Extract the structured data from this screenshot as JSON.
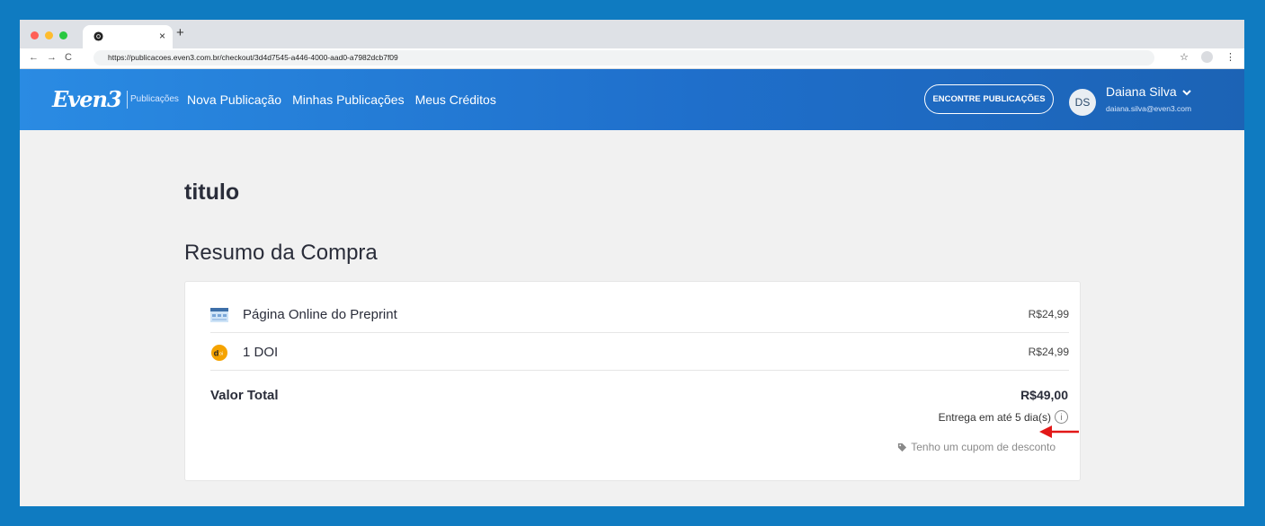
{
  "browser": {
    "url": "https://publicacoes.even3.com.br/checkout/3d4d7545-a446-4000-aad0-a7982dcb7f09",
    "tab_close": "×",
    "new_tab": "+"
  },
  "header": {
    "logo": "Even3",
    "logo_sub": "Publicações",
    "nav": [
      "Nova Publicação",
      "Minhas Publicações",
      "Meus Créditos"
    ],
    "find_button": "ENCONTRE PUBLICAÇÕES",
    "user": {
      "initials": "DS",
      "name": "Daiana Silva",
      "email": "daiana.silva@even3.com"
    }
  },
  "page": {
    "title": "titulo",
    "subtitle": "Resumo da Compra"
  },
  "order": {
    "items": [
      {
        "label": "Página Online do Preprint",
        "price": "R$24,99",
        "icon": "webpage-icon"
      },
      {
        "label": "1 DOI",
        "price": "R$24,99",
        "icon": "doi-icon"
      }
    ],
    "total_label": "Valor Total",
    "total_value": "R$49,00",
    "delivery": "Entrega em até 5 dia(s)",
    "coupon": "Tenho um cupom de desconto"
  },
  "colors": {
    "background": "#0f7bc1",
    "header_start": "#2a8be3",
    "header_end": "#1c63b5",
    "doi_badge": "#f5a300",
    "annotation_arrow": "#e21818"
  }
}
